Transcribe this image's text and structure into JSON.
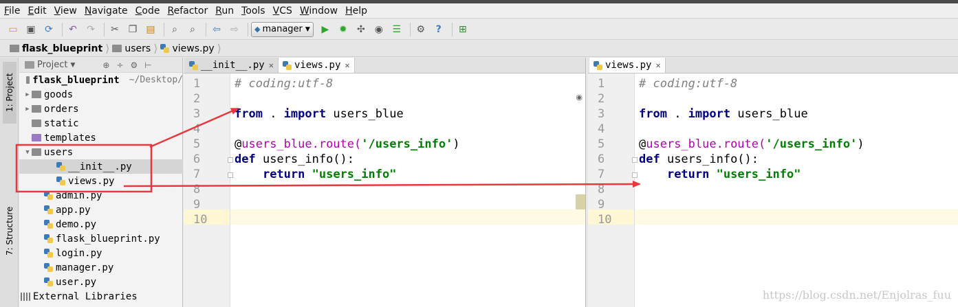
{
  "menu": [
    "File",
    "Edit",
    "View",
    "Navigate",
    "Code",
    "Refactor",
    "Run",
    "Tools",
    "VCS",
    "Window",
    "Help"
  ],
  "toolbar": {
    "run_config": "manager"
  },
  "breadcrumb": [
    "flask_blueprint",
    "users",
    "views.py"
  ],
  "side_tabs": {
    "project": "1: Project",
    "structure": "7: Structure"
  },
  "project_panel": {
    "title": "Project",
    "root_name": "flask_blueprint",
    "root_path": "~/Desktop/",
    "items": [
      {
        "label": "goods",
        "type": "folder"
      },
      {
        "label": "orders",
        "type": "folder"
      },
      {
        "label": "static",
        "type": "folder"
      },
      {
        "label": "templates",
        "type": "folder"
      },
      {
        "label": "users",
        "type": "folder"
      },
      {
        "label": "__init__.py",
        "type": "file"
      },
      {
        "label": "views.py",
        "type": "file"
      },
      {
        "label": "admin.py",
        "type": "file"
      },
      {
        "label": "app.py",
        "type": "file"
      },
      {
        "label": "demo.py",
        "type": "file"
      },
      {
        "label": "flask_blueprint.py",
        "type": "file"
      },
      {
        "label": "login.py",
        "type": "file"
      },
      {
        "label": "manager.py",
        "type": "file"
      },
      {
        "label": "user.py",
        "type": "file"
      }
    ],
    "external_libraries": "External Libraries"
  },
  "editor_left": {
    "tabs": [
      "__init__.py",
      "views.py"
    ],
    "line_numbers": [
      "1",
      "2",
      "3",
      "4",
      "5",
      "6",
      "7",
      "8",
      "9",
      "10"
    ]
  },
  "editor_right": {
    "tabs": [
      "views.py"
    ],
    "line_numbers": [
      "1",
      "2",
      "3",
      "4",
      "5",
      "6",
      "7",
      "8",
      "9",
      "10"
    ]
  },
  "code": {
    "line1": "# coding:utf-8",
    "from": "from",
    "dot": " . ",
    "import": "import",
    "import_name": " users_blue",
    "decorator_at": "@",
    "decorator_name": "users_blue.route(",
    "route_str": "'/users_info'",
    "close_paren": ")",
    "def": "def",
    "func_sig": " users_info():",
    "return": "return",
    "return_str": "\"users_info\""
  },
  "annotation_color": "#e8383d",
  "watermark": "https://blog.csdn.net/Enjolras_fuu"
}
